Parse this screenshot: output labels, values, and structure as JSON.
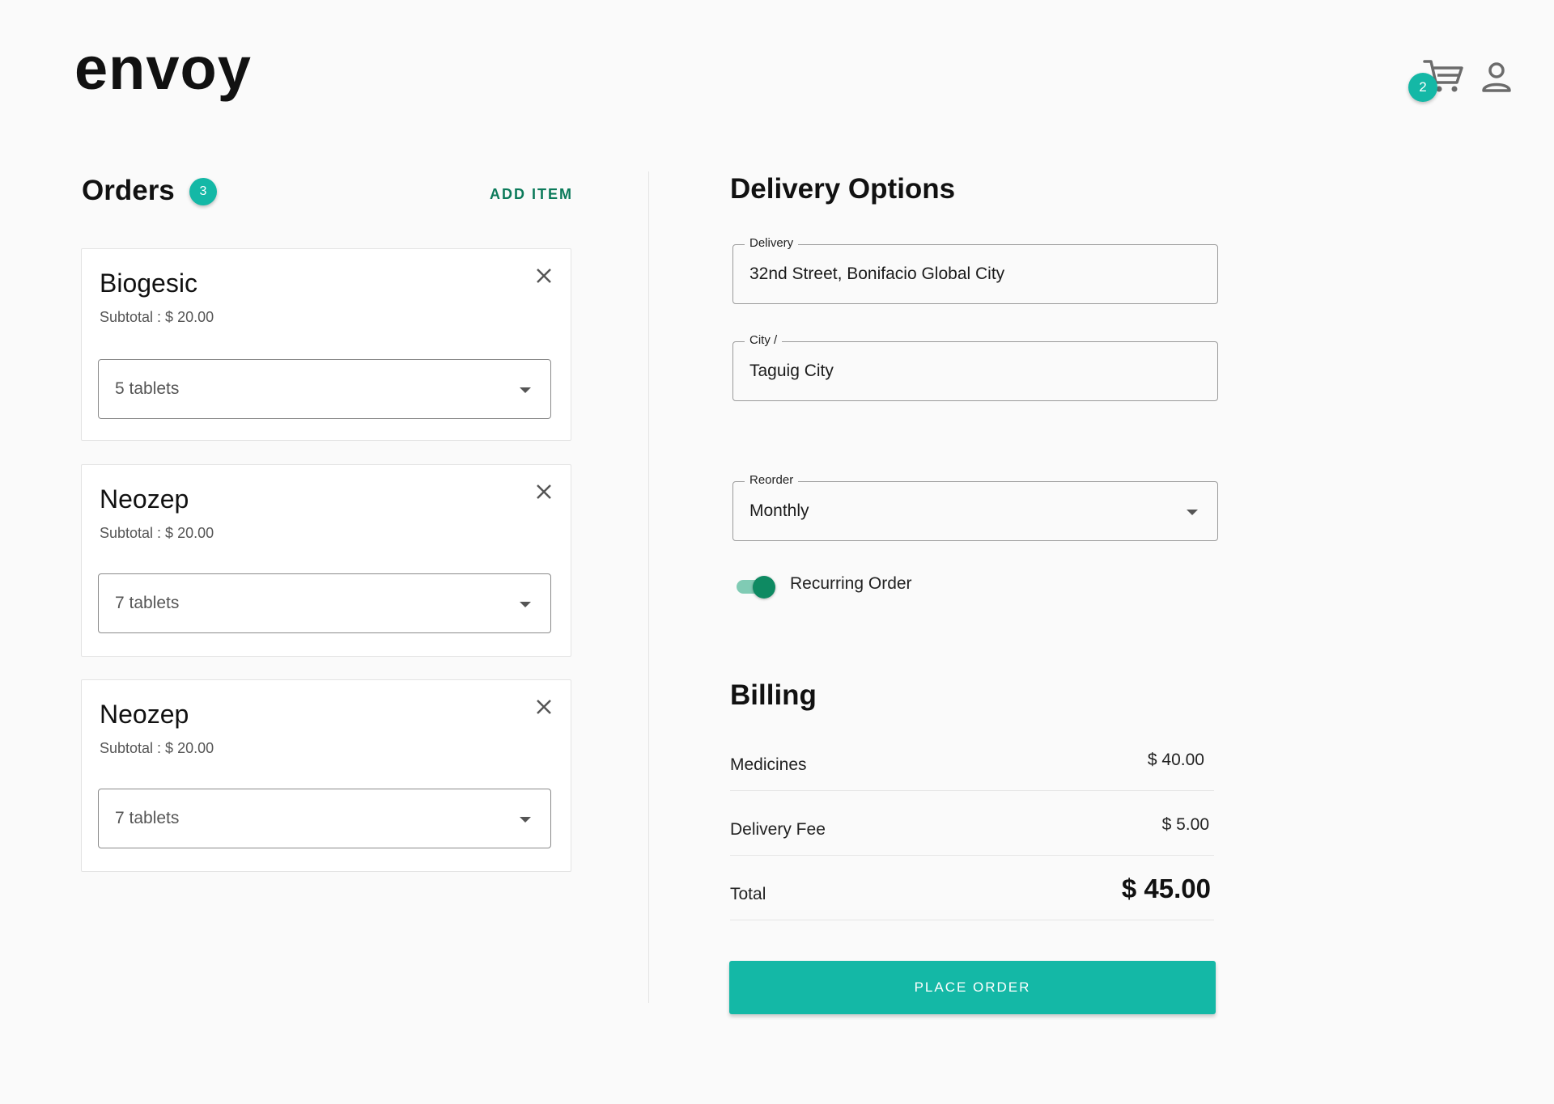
{
  "app": {
    "logo": "envoy"
  },
  "header": {
    "cart_count": "2",
    "cart_icon": "cart-icon",
    "user_icon": "user-icon"
  },
  "orders": {
    "title": "Orders",
    "count": "3",
    "add_item_label": "ADD ITEM",
    "items": [
      {
        "name": "Biogesic",
        "subtotal": "Subtotal : $ 20.00",
        "quantity": "5 tablets"
      },
      {
        "name": "Neozep",
        "subtotal": "Subtotal : $ 20.00",
        "quantity": "7 tablets"
      },
      {
        "name": "Neozep",
        "subtotal": "Subtotal : $ 20.00",
        "quantity": "7 tablets"
      }
    ]
  },
  "delivery": {
    "title": "Delivery Options",
    "address_label": "Delivery",
    "address_value": "32nd Street, Bonifacio Global City",
    "city_label": "City /",
    "city_value": "Taguig City",
    "reorder_label": "Reorder",
    "reorder_value": "Monthly",
    "recurring_label": "Recurring Order",
    "recurring_on": true
  },
  "billing": {
    "title": "Billing",
    "medicines_label": "Medicines",
    "medicines_value": "$ 40.00",
    "delivery_fee_label": "Delivery Fee",
    "delivery_fee_value": "$ 5.00",
    "total_label": "Total",
    "total_value": "$ 45.00"
  },
  "actions": {
    "place_order_label": "PLACE ORDER"
  },
  "colors": {
    "accent": "#14b8a6",
    "accent_dark": "#0b7a5a",
    "toggle_on": "#0e8a62"
  }
}
